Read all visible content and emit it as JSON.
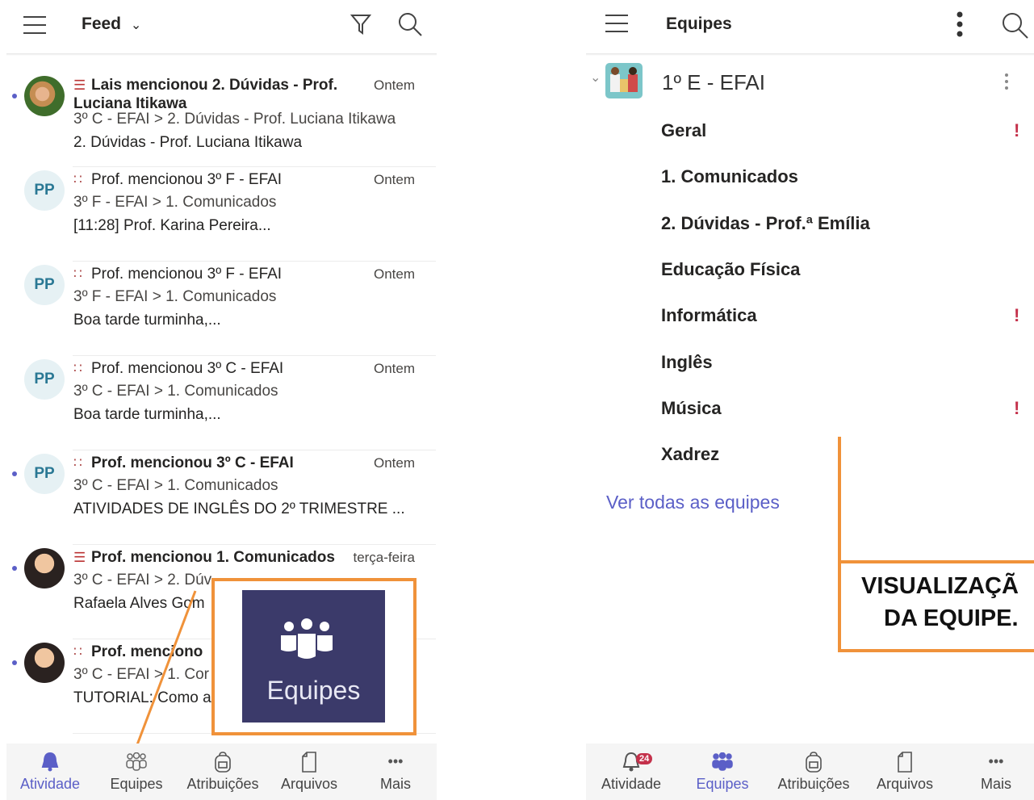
{
  "left": {
    "header": {
      "title": "Feed"
    },
    "feed": [
      {
        "avatar_type": "photo1",
        "initials": "",
        "icon": "post-icon",
        "line1": "Lais mencionou 2. Dúvidas - Prof. Luciana Itikawa",
        "bold": true,
        "time": "Ontem",
        "line2": "3º C - EFAI  > 2. Dúvidas - Prof. Luciana Itikawa",
        "line3": "2. Dúvidas - Prof. Luciana Itikawa",
        "unread": true
      },
      {
        "avatar_type": "pp",
        "initials": "PP",
        "icon": "team-icon",
        "line1": "Prof. mencionou 3º F - EFAI",
        "bold": false,
        "time": "Ontem",
        "line2": "3º F - EFAI  > 1. Comunicados",
        "line3": "[11:28] Prof. Karina Pereira...",
        "unread": false
      },
      {
        "avatar_type": "pp",
        "initials": "PP",
        "icon": "team-icon",
        "line1": "Prof. mencionou 3º F - EFAI",
        "bold": false,
        "time": "Ontem",
        "line2": "3º F - EFAI  > 1. Comunicados",
        "line3": "Boa tarde turminha,...",
        "unread": false
      },
      {
        "avatar_type": "pp",
        "initials": "PP",
        "icon": "team-icon",
        "line1": "Prof. mencionou 3º C - EFAI",
        "bold": false,
        "time": "Ontem",
        "line2": "3º C - EFAI  > 1. Comunicados",
        "line3": "Boa tarde turminha,...",
        "unread": false
      },
      {
        "avatar_type": "pp",
        "initials": "PP",
        "icon": "team-icon",
        "line1": "Prof. mencionou 3º C - EFAI",
        "bold": true,
        "time": "Ontem",
        "line2": "3º C - EFAI  > 1. Comunicados",
        "line3": "ATIVIDADES DE INGLÊS DO 2º TRIMESTRE ...",
        "unread": true
      },
      {
        "avatar_type": "photo",
        "initials": "",
        "icon": "post-icon",
        "line1": "Prof. mencionou 1. Comunicados",
        "bold": true,
        "time": "terça-feira",
        "line2": "3º C - EFAI  > 2. Dúv",
        "line3": "Rafaela Alves Gom",
        "unread": true
      },
      {
        "avatar_type": "photo",
        "initials": "",
        "icon": "team-icon",
        "line1": "Prof. menciono",
        "bold": true,
        "time": "",
        "line2": "3º C - EFAI  > 1. Cor",
        "line3": "TUTORIAL: Como a",
        "unread": true
      }
    ],
    "callout_label": "Equipes",
    "tabs": [
      {
        "label": "Atividade",
        "icon": "bell-icon",
        "active": true
      },
      {
        "label": "Equipes",
        "icon": "teams-icon",
        "active": false
      },
      {
        "label": "Atribuições",
        "icon": "backpack-icon",
        "active": false
      },
      {
        "label": "Arquivos",
        "icon": "file-icon",
        "active": false
      },
      {
        "label": "Mais",
        "icon": "more-icon",
        "active": false
      }
    ]
  },
  "right": {
    "header": {
      "title": "Equipes"
    },
    "team": {
      "name": "1º E - EFAI"
    },
    "channels": [
      {
        "name": "Geral",
        "alert": true
      },
      {
        "name": "1. Comunicados",
        "alert": false
      },
      {
        "name": "2. Dúvidas - Prof.ª Emília",
        "alert": false
      },
      {
        "name": "Educação Física",
        "alert": false
      },
      {
        "name": "Informática",
        "alert": true
      },
      {
        "name": "Inglês",
        "alert": false
      },
      {
        "name": "Música",
        "alert": true
      },
      {
        "name": "Xadrez",
        "alert": false
      }
    ],
    "see_all": "Ver todas as equipes",
    "annotation": {
      "line1": "VISUALIZAÇÃ",
      "line2": "DA EQUIPE."
    },
    "activity_badge": "24",
    "tabs": [
      {
        "label": "Atividade",
        "icon": "bell-icon",
        "active": false
      },
      {
        "label": "Equipes",
        "icon": "teams-icon",
        "active": true
      },
      {
        "label": "Atribuições",
        "icon": "backpack-icon",
        "active": false
      },
      {
        "label": "Arquivos",
        "icon": "file-icon",
        "active": false
      },
      {
        "label": "Mais",
        "icon": "more-icon",
        "active": false
      }
    ]
  },
  "colors": {
    "accent": "#5b5fc7",
    "orange": "#f0923a",
    "alert": "#c4314b",
    "teams_tile": "#3b3a6a"
  }
}
